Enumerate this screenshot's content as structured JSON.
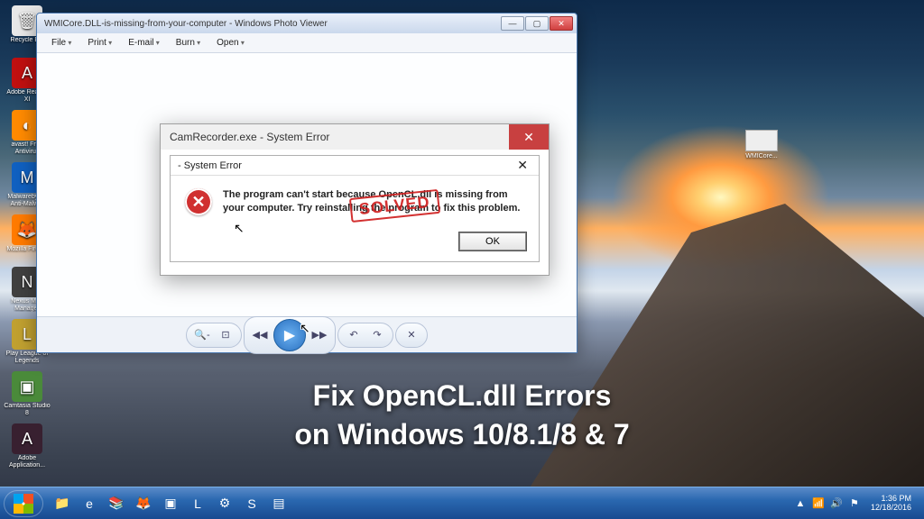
{
  "desktop_icons": [
    {
      "label": "Recycle Bin",
      "bg": "#e8e8e8",
      "glyph": "🗑"
    },
    {
      "label": "Adobe Reader XI",
      "bg": "#c01010",
      "glyph": "A"
    },
    {
      "label": "avast! Free Antivirus",
      "bg": "#ff8a00",
      "glyph": "◐"
    },
    {
      "label": "Malwarebytes Anti-Malwar",
      "bg": "#1060c0",
      "glyph": "M"
    },
    {
      "label": "Mozilla Firefox",
      "bg": "#ff7a00",
      "glyph": "🦊"
    },
    {
      "label": "Nexus Mod Manager",
      "bg": "#404040",
      "glyph": "N"
    },
    {
      "label": "Play League of Legends",
      "bg": "#c0a030",
      "glyph": "L"
    },
    {
      "label": "Camtasia Studio 8",
      "bg": "#4a8a3a",
      "glyph": "▣"
    },
    {
      "label": "Adobe Application...",
      "bg": "#382030",
      "glyph": "A"
    }
  ],
  "lone_icon": {
    "label": "WMICore..."
  },
  "promo": {
    "line1": "Fix OpenCL.dll Errors",
    "line2": "on Windows 10/8.1/8 & 7"
  },
  "taskbar": {
    "pinned": [
      "📁",
      "e",
      "📚",
      "🦊",
      "▣",
      "L",
      "⚙",
      "S",
      "▤"
    ],
    "tray": [
      "▲",
      "📶",
      "🔊",
      "⚑"
    ],
    "time": "1:36 PM",
    "date": "12/18/2016"
  },
  "photo_viewer": {
    "title": "WMICore.DLL-is-missing-from-your-computer - Windows Photo Viewer",
    "menu": [
      "File",
      "Print",
      "E-mail",
      "Burn",
      "Open"
    ],
    "tools": {
      "zoom_out": "🔍-",
      "fit": "⊡",
      "prev": "◀◀",
      "play": "▶",
      "next": "▶▶",
      "rotl": "↶",
      "rotr": "↷",
      "del": "✕"
    }
  },
  "error_outer": {
    "title": "CamRecorder.exe - System Error"
  },
  "error_inner": {
    "title": "- System Error",
    "message": "The program can't start because OpenCL.dll is missing from your computer. Try reinstalling the program to fix this problem.",
    "ok": "OK",
    "stamp": "SOLVED"
  }
}
